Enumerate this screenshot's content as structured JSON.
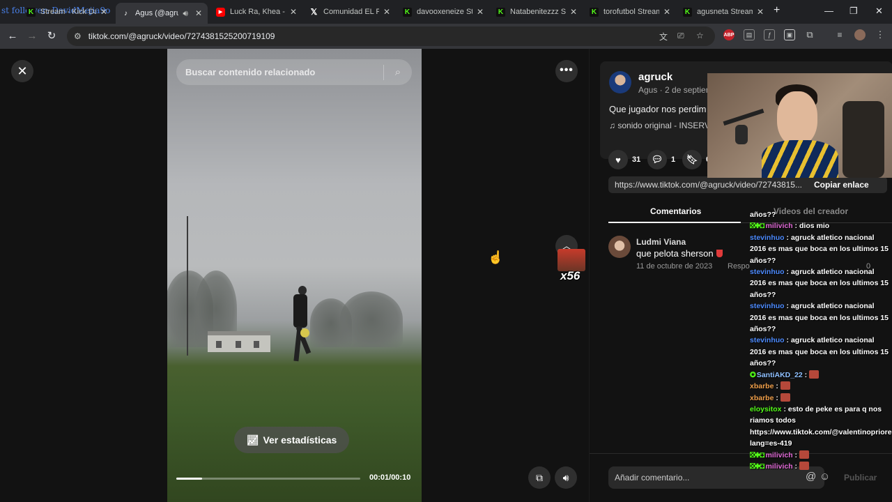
{
  "overlay_text": "st follower: DavidMejia9o",
  "tabs": [
    {
      "label": "Stream - Kick Da",
      "icon": "kick-icon",
      "active": false
    },
    {
      "label": "Agus (@agruc",
      "icon": "tiktok-icon",
      "active": true
    },
    {
      "label": "Luck Ra, Khea - H",
      "icon": "youtube-icon",
      "active": false
    },
    {
      "label": "Comunidad EL PL",
      "icon": "x-icon",
      "active": false
    },
    {
      "label": "davooxeneize Stre",
      "icon": "kick-icon",
      "active": false
    },
    {
      "label": "Natabenitezzz Str",
      "icon": "kick-icon",
      "active": false
    },
    {
      "label": "torofutbol Stream",
      "icon": "kick-icon",
      "active": false
    },
    {
      "label": "agusneta Stream",
      "icon": "kick-icon",
      "active": false
    }
  ],
  "omnibox": {
    "url": "tiktok.com/@agruck/video/7274381525200719109"
  },
  "extensions": {
    "adblock": "ABP"
  },
  "video": {
    "search_placeholder": "Buscar contenido relacionado",
    "stats_button": "Ver estadísticas",
    "time": "00:01/00:10",
    "progress": 0.14
  },
  "emote_overlay": {
    "count": "x56"
  },
  "post": {
    "username": "agruck",
    "subline": "Agus · 2 de septien",
    "description": "Que jugador nos perdim",
    "music": "sonido original - INSERV",
    "likes": "31",
    "comments": "1",
    "saves": "0",
    "link": "https://www.tiktok.com/@agruck/video/72743815...",
    "copy_label": "Copiar enlace"
  },
  "comment_tabs": {
    "comments": "Comentarios",
    "creator_videos": "Videos del creador"
  },
  "comment": {
    "user": "Ludmi Viana",
    "text": "que pelota sherson",
    "date": "11 de octubre de 2023",
    "reply": "Respo",
    "likes": "0"
  },
  "comment_bar": {
    "placeholder": "Añadir comentario...",
    "publish": "Publicar"
  },
  "chat": [
    {
      "user": "",
      "text": "años??",
      "color": "#ffffff",
      "badges": "",
      "emote": false
    },
    {
      "user": "milivich",
      "text": "dios mio",
      "color": "#e36bd8",
      "badges": "⛝✚⚃",
      "emote": false
    },
    {
      "user": "stevinhuo",
      "text": "agruck atletico nacional 2016 es mas que boca en los ultimos 15 años??",
      "color": "#4d8bff",
      "badges": "",
      "emote": false
    },
    {
      "user": "stevinhuo",
      "text": "agruck atletico nacional 2016 es mas que boca en los ultimos 15 años??",
      "color": "#4d8bff",
      "badges": "",
      "emote": false
    },
    {
      "user": "stevinhuo",
      "text": "agruck atletico nacional 2016 es mas que boca en los ultimos 15 años??",
      "color": "#4d8bff",
      "badges": "",
      "emote": false
    },
    {
      "user": "stevinhuo",
      "text": "agruck atletico nacional 2016 es mas que boca en los ultimos 15 años??",
      "color": "#4d8bff",
      "badges": "",
      "emote": false
    },
    {
      "user": "SantiAKD_22",
      "text": "",
      "color": "#8fc0ff",
      "badges": "✪",
      "emote": true
    },
    {
      "user": "xbarbe",
      "text": "",
      "color": "#f0a04b",
      "badges": "",
      "emote": true
    },
    {
      "user": "xbarbe",
      "text": "",
      "color": "#f0a04b",
      "badges": "",
      "emote": true
    },
    {
      "user": "eloysitox",
      "text": "esto de peke es para q nos riamos todos https://www.tiktok.com/@valentinopriore?lang=es-419",
      "color": "#53fc18",
      "badges": "",
      "emote": false
    },
    {
      "user": "milivich",
      "text": "",
      "color": "#e36bd8",
      "badges": "⛝✚⚃",
      "emote": true
    },
    {
      "user": "milivich",
      "text": "",
      "color": "#e36bd8",
      "badges": "⛝✚⚃",
      "emote": true
    }
  ]
}
